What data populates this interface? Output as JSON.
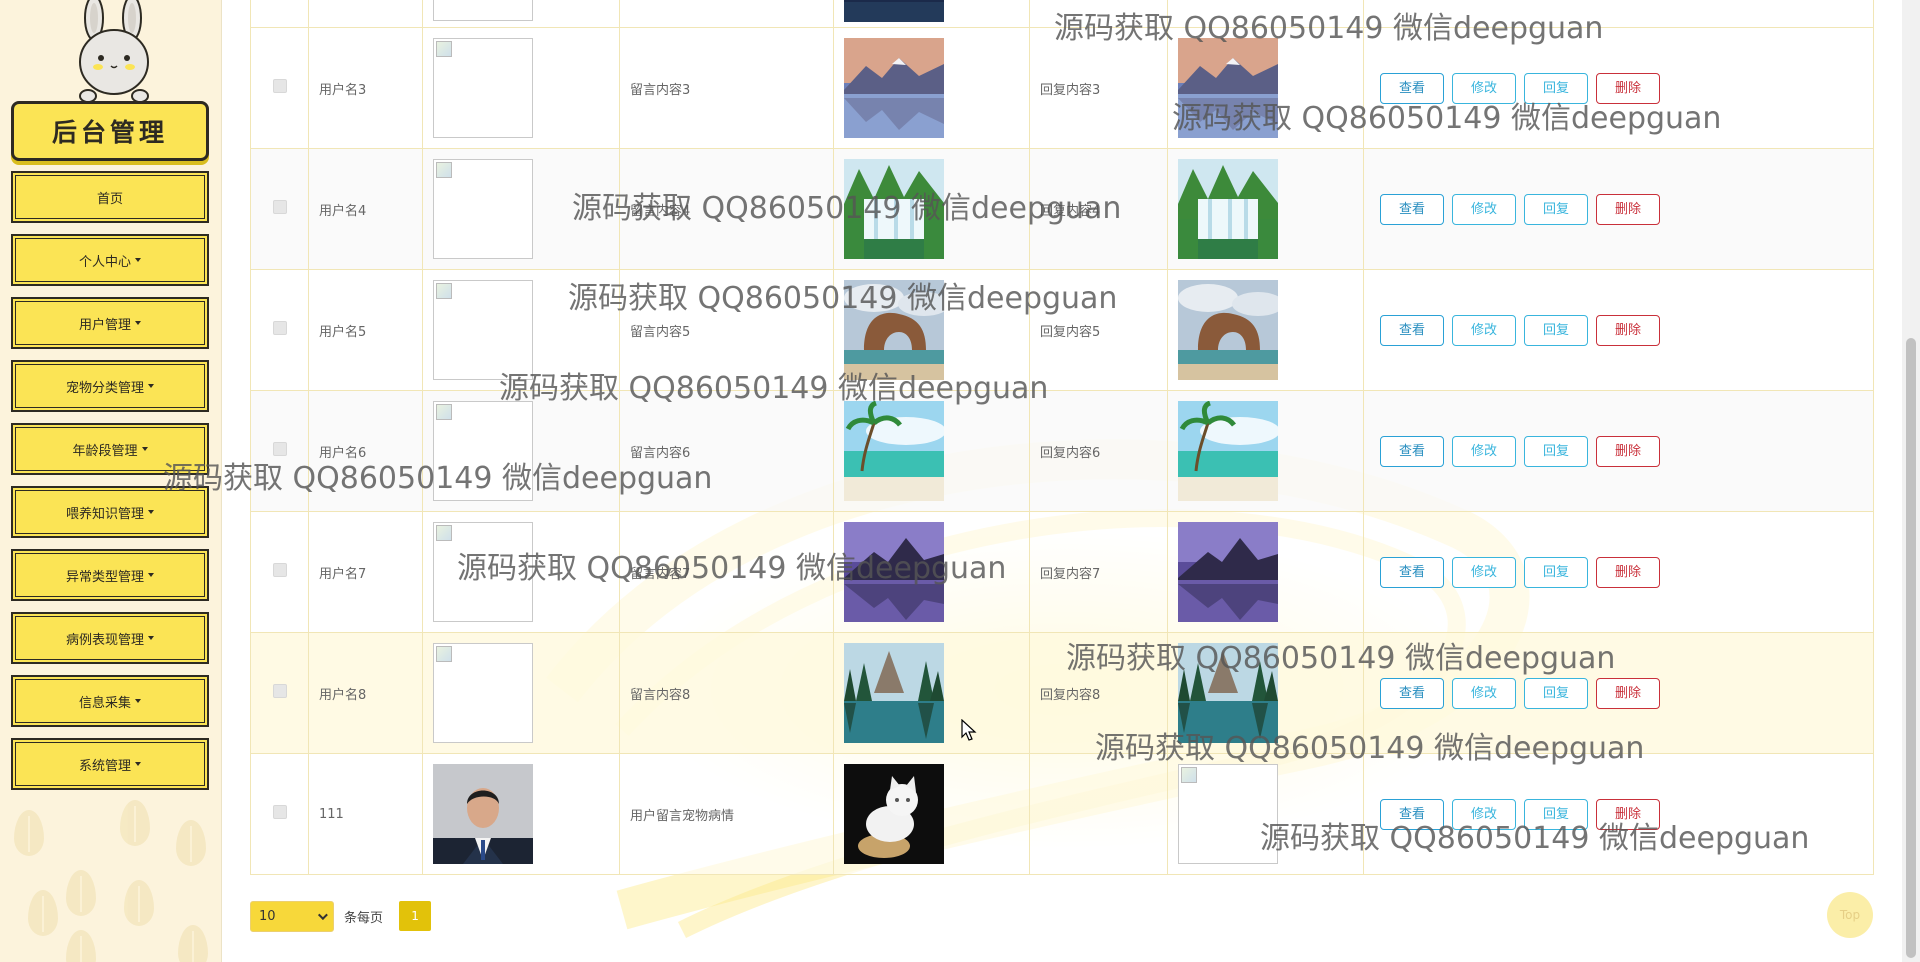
{
  "sidebar": {
    "brand": "后台管理",
    "items": [
      {
        "label": "首页",
        "dropdown": false
      },
      {
        "label": "个人中心",
        "dropdown": true
      },
      {
        "label": "用户管理",
        "dropdown": true
      },
      {
        "label": "宠物分类管理",
        "dropdown": true
      },
      {
        "label": "年龄段管理",
        "dropdown": true
      },
      {
        "label": "喂养知识管理",
        "dropdown": true
      },
      {
        "label": "异常类型管理",
        "dropdown": true
      },
      {
        "label": "病例表现管理",
        "dropdown": true
      },
      {
        "label": "信息采集",
        "dropdown": true
      },
      {
        "label": "系统管理",
        "dropdown": true
      }
    ]
  },
  "table": {
    "actions": {
      "view": "查看",
      "edit": "修改",
      "reply": "回复",
      "delete": "删除"
    },
    "rows": [
      {
        "username": "用户名3",
        "message": "留言内容3",
        "reply": "回复内容3",
        "msg_image": "mountain-lake-sunset",
        "reply_image": "mountain-lake-sunset"
      },
      {
        "username": "用户名4",
        "message": "留言内容4",
        "reply": "回复内容4",
        "msg_image": "waterfall-green",
        "reply_image": "waterfall-green"
      },
      {
        "username": "用户名5",
        "message": "留言内容5",
        "reply": "回复内容5",
        "msg_image": "sea-rock-arch",
        "reply_image": "sea-rock-arch"
      },
      {
        "username": "用户名6",
        "message": "留言内容6",
        "reply": "回复内容6",
        "msg_image": "tropical-beach",
        "reply_image": "tropical-beach"
      },
      {
        "username": "用户名7",
        "message": "留言内容7",
        "reply": "回复内容7",
        "msg_image": "purple-mountain-lake",
        "reply_image": "purple-mountain-lake"
      },
      {
        "username": "用户名8",
        "message": "留言内容8",
        "reply": "回复内容8",
        "msg_image": "forest-lake",
        "reply_image": "forest-lake"
      },
      {
        "username": "111",
        "message": "用户留言宠物病情",
        "reply": "",
        "msg_image": "white-kitten",
        "reply_image": "broken"
      }
    ]
  },
  "pager": {
    "page_size": "10",
    "per_page_label": "条每页",
    "current_page": "1"
  },
  "top_button": "Top",
  "watermark": "源码获取 QQ86050149 微信deepguan",
  "colors": {
    "accent": "#fbe455",
    "view": "#2a8fc0",
    "edit": "#39b5dd",
    "delete": "#c9303a",
    "page_active": "#e2c20a"
  }
}
